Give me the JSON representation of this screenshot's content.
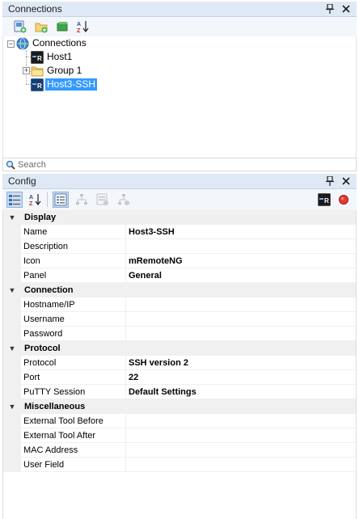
{
  "connections_panel": {
    "title": "Connections",
    "pin_glyph": "⍒",
    "close_glyph": "✕",
    "toolbar": [
      "new-connection-icon",
      "new-folder-icon",
      "expand-all-icon",
      "sort-ascending-icon"
    ],
    "tree": {
      "root": "Connections",
      "items": [
        {
          "label": "Host1",
          "icon": "putty-icon",
          "expander": "",
          "selected": false
        },
        {
          "label": "Group 1",
          "icon": "folder-icon",
          "expander": "+",
          "selected": false
        },
        {
          "label": "Host3-SSH",
          "icon": "putty-icon",
          "expander": "",
          "selected": true
        }
      ]
    },
    "search_placeholder": "Search"
  },
  "config_panel": {
    "title": "Config",
    "pin_glyph": "⍒",
    "close_glyph": "✕",
    "toolbar_left": [
      "categorized-icon",
      "alphabetical-icon",
      "properties-icon",
      "inheritance-icon",
      "default-properties-icon",
      "default-inheritance-icon"
    ],
    "toolbar_right": [
      "host-status-icon",
      "record-icon"
    ],
    "categories": [
      {
        "name": "Display",
        "collapse_glyph": "▼",
        "rows": [
          {
            "name": "Name",
            "value": "Host3-SSH"
          },
          {
            "name": "Description",
            "value": ""
          },
          {
            "name": "Icon",
            "value": "mRemoteNG"
          },
          {
            "name": "Panel",
            "value": "General"
          }
        ]
      },
      {
        "name": "Connection",
        "collapse_glyph": "▼",
        "rows": [
          {
            "name": "Hostname/IP",
            "value": ""
          },
          {
            "name": "Username",
            "value": ""
          },
          {
            "name": "Password",
            "value": ""
          }
        ]
      },
      {
        "name": "Protocol",
        "collapse_glyph": "▼",
        "rows": [
          {
            "name": "Protocol",
            "value": "SSH version 2"
          },
          {
            "name": "Port",
            "value": "22"
          },
          {
            "name": "PuTTY Session",
            "value": "Default Settings"
          }
        ]
      },
      {
        "name": "Miscellaneous",
        "collapse_glyph": "▼",
        "rows": [
          {
            "name": "External Tool Before",
            "value": ""
          },
          {
            "name": "External Tool After",
            "value": ""
          },
          {
            "name": "MAC Address",
            "value": ""
          },
          {
            "name": "User Field",
            "value": ""
          }
        ]
      }
    ]
  }
}
